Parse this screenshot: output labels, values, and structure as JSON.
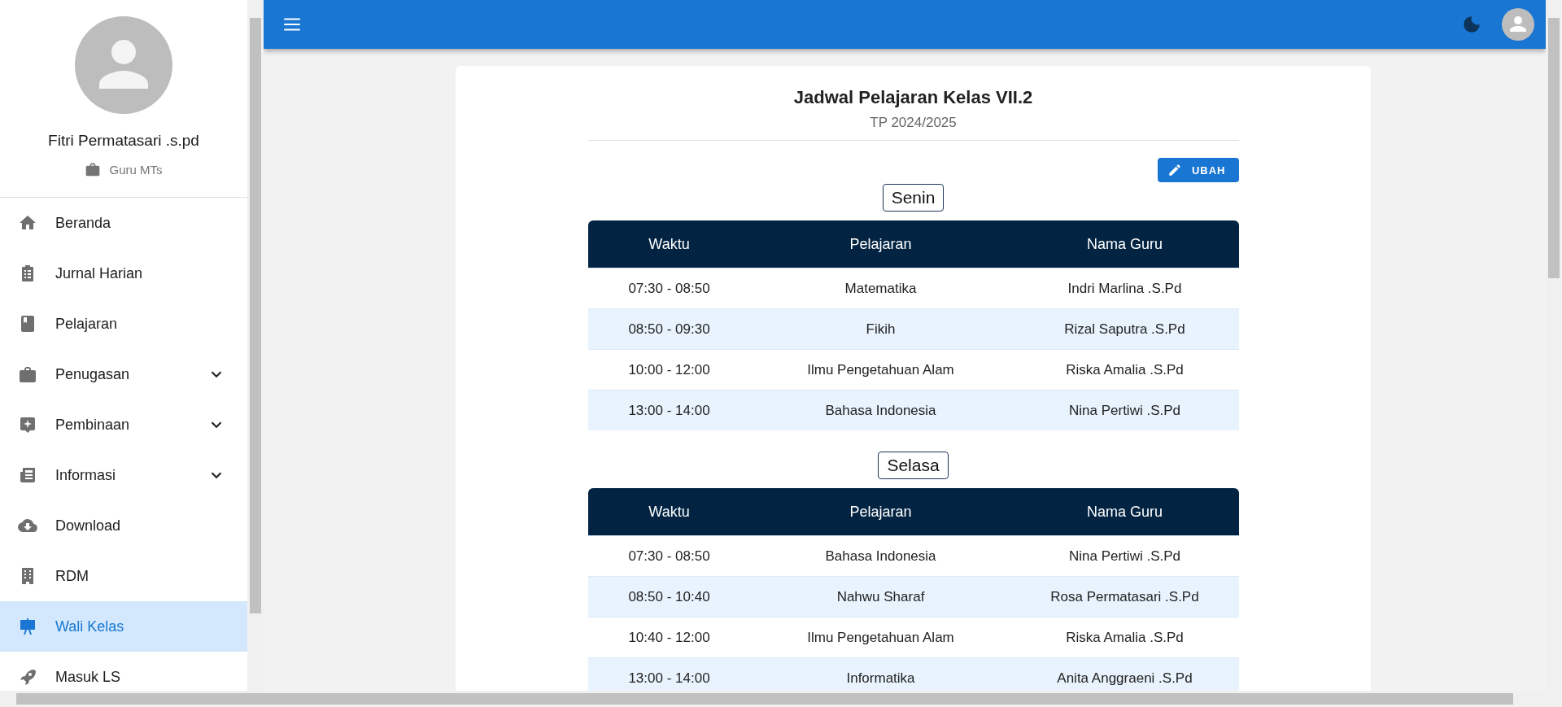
{
  "sidebar": {
    "profile": {
      "name": "Fitri Permatasari .s.pd",
      "role": "Guru MTs"
    },
    "items": [
      {
        "label": "Beranda",
        "has_submenu": false,
        "selected": false
      },
      {
        "label": "Jurnal Harian",
        "has_submenu": false,
        "selected": false
      },
      {
        "label": "Pelajaran",
        "has_submenu": false,
        "selected": false
      },
      {
        "label": "Penugasan",
        "has_submenu": true,
        "selected": false
      },
      {
        "label": "Pembinaan",
        "has_submenu": true,
        "selected": false
      },
      {
        "label": "Informasi",
        "has_submenu": true,
        "selected": false
      },
      {
        "label": "Download",
        "has_submenu": false,
        "selected": false
      },
      {
        "label": "RDM",
        "has_submenu": false,
        "selected": false
      },
      {
        "label": "Wali Kelas",
        "has_submenu": false,
        "selected": true
      },
      {
        "label": "Masuk LS",
        "has_submenu": false,
        "selected": false
      }
    ]
  },
  "card": {
    "title": "Jadwal Pelajaran Kelas VII.2",
    "subtitle": "TP 2024/2025",
    "edit_button": "UBAH",
    "days": [
      {
        "day": "Senin",
        "columns": [
          "Waktu",
          "Pelajaran",
          "Nama Guru"
        ],
        "rows": [
          [
            "07:30 - 08:50",
            "Matematika",
            "Indri Marlina .S.Pd"
          ],
          [
            "08:50 - 09:30",
            "Fikih",
            "Rizal Saputra .S.Pd"
          ],
          [
            "10:00 - 12:00",
            "Ilmu Pengetahuan Alam",
            "Riska Amalia .S.Pd"
          ],
          [
            "13:00 - 14:00",
            "Bahasa Indonesia",
            "Nina Pertiwi .S.Pd"
          ]
        ]
      },
      {
        "day": "Selasa",
        "columns": [
          "Waktu",
          "Pelajaran",
          "Nama Guru"
        ],
        "rows": [
          [
            "07:30 - 08:50",
            "Bahasa Indonesia",
            "Nina Pertiwi .S.Pd"
          ],
          [
            "08:50 - 10:40",
            "Nahwu Sharaf",
            "Rosa Permatasari .S.Pd"
          ],
          [
            "10:40 - 12:00",
            "Ilmu Pengetahuan Alam",
            "Riska Amalia .S.Pd"
          ],
          [
            "13:00 - 14:00",
            "Informatika",
            "Anita Anggraeni .S.Pd"
          ]
        ]
      }
    ]
  }
}
